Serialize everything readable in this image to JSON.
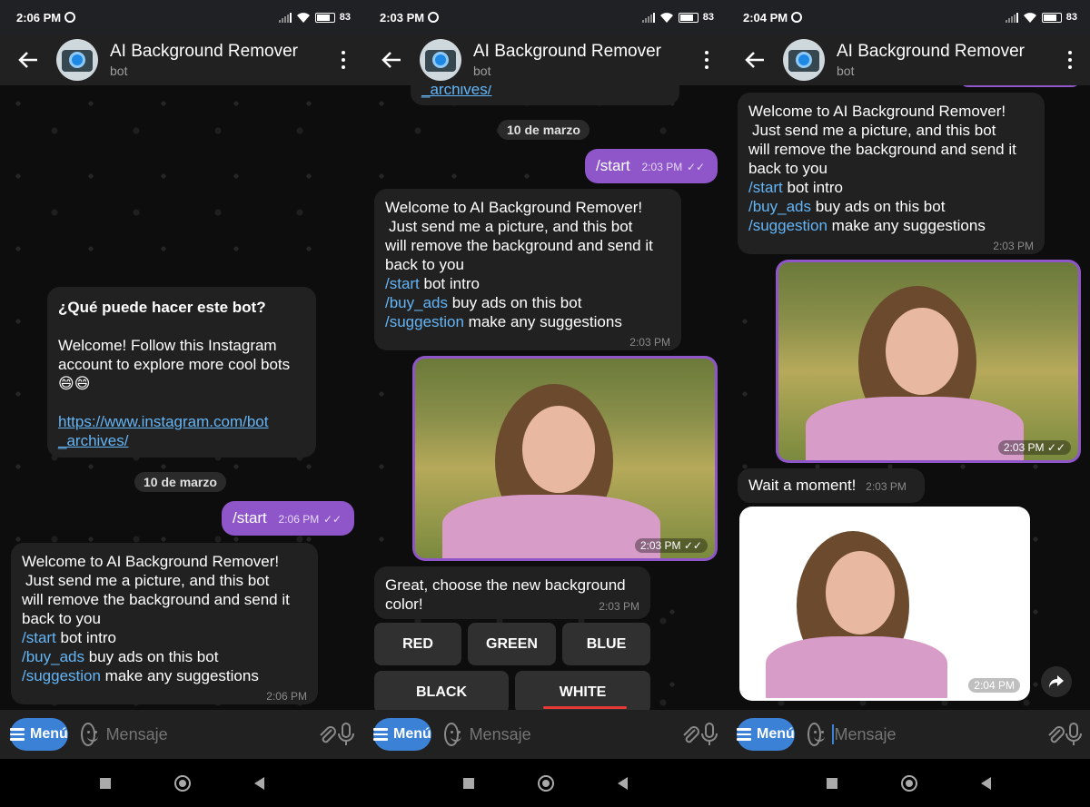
{
  "status": [
    {
      "time": "2:06 PM",
      "battery": "83"
    },
    {
      "time": "2:03 PM",
      "battery": "83"
    },
    {
      "time": "2:04 PM",
      "battery": "83"
    }
  ],
  "header": {
    "title": "AI Background Remover",
    "subtitle": "bot"
  },
  "input": {
    "menu_label": "Menú",
    "placeholder": "Mensaje"
  },
  "screen1": {
    "info_title": "¿Qué puede hacer este bot?",
    "info_body": "Welcome! Follow this Instagram account to explore more cool bots",
    "info_emoji": "😄😄",
    "info_link_1": "https://www.instagram.com/bot",
    "info_link_2": "_archives/",
    "date": "10 de marzo",
    "start_cmd": "/start",
    "start_time": "2:06 PM",
    "welcome_l1": "Welcome to AI Background Remover!",
    "welcome_l2": "Just send me a picture, and this bot",
    "welcome_l3": "will remove the background and send it",
    "welcome_l4": "back to you",
    "cmd_start": "/start",
    "cmd_start_desc": " bot intro",
    "cmd_ads": "/buy_ads",
    "cmd_ads_desc": " buy ads on this bot",
    "cmd_sugg": "/suggestion",
    "cmd_sugg_desc": " make any suggestions",
    "welcome_time": "2:06 PM"
  },
  "screen2": {
    "top_link": "_archives/",
    "date": "10 de marzo",
    "start_cmd": "/start",
    "start_time": "2:03 PM",
    "welcome_time": "2:03 PM",
    "photo_time": "2:03 PM",
    "choose_text": "Great, choose the new background color!",
    "choose_time": "2:03 PM",
    "buttons": [
      "RED",
      "GREEN",
      "BLUE",
      "BLACK",
      "WHITE"
    ]
  },
  "screen3": {
    "welcome_time": "2:03 PM",
    "photo_time": "2:03 PM",
    "wait_text": "Wait a moment!",
    "wait_time": "2:03 PM",
    "result_time": "2:04 PM"
  },
  "colors": {
    "outgoing": "#8e56c9",
    "incoming": "#212121",
    "link": "#64b5f6",
    "menu": "#3b82d6",
    "underline": "#e53935"
  }
}
